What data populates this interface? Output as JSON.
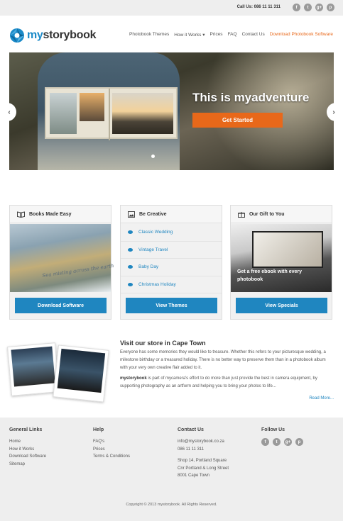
{
  "topbar": {
    "call_text": "Call Us: 086 11 11 311",
    "social": [
      {
        "icon": "facebook-icon",
        "glyph": "f"
      },
      {
        "icon": "twitter-icon",
        "glyph": "t"
      },
      {
        "icon": "google-plus-icon",
        "glyph": "g+"
      },
      {
        "icon": "pinterest-icon",
        "glyph": "p"
      }
    ]
  },
  "brand": {
    "my": "my",
    "rest": "storybook"
  },
  "nav": [
    {
      "label": "Photobook Themes"
    },
    {
      "label": "How it Works ▾"
    },
    {
      "label": "Prices"
    },
    {
      "label": "FAQ"
    },
    {
      "label": "Contact Us"
    },
    {
      "label": "Download Photobook Software",
      "highlight": true
    }
  ],
  "hero": {
    "title": "This is myadventure",
    "cta": "Get Started",
    "prev": "‹",
    "next": "›"
  },
  "cards": {
    "books": {
      "title": "Books Made Easy",
      "script": "Sea misting across the earth",
      "button": "Download Software"
    },
    "creative": {
      "title": "Be Creative",
      "links": [
        "Classic Wedding",
        "Vintage Travel",
        "Baby Day",
        "Christmas Holiday"
      ],
      "button": "View Themes"
    },
    "gift": {
      "title": "Our Gift to You",
      "overlay": "Get a free ebook with every photobook",
      "button": "View Specials"
    }
  },
  "store": {
    "title": "Visit our store in Cape Town",
    "p1": "Everyone has some memories they would like to treasure. Whether this refers to your picturesque wedding, a milestone birthday or a treasured holiday. There is no better way to preserve them than in a photobook album with your very own creative flair added to it.",
    "p2_brand": "mystorybook",
    "p2": " is part of mycamera's effort to do more than just provide the best in camera equipment, by supporting photography as an artform and helping you to bring your photos to life...",
    "read_more": "Read More..."
  },
  "footer": {
    "general": {
      "heading": "General Links",
      "links": [
        "Home",
        "How it Works",
        "Download Software",
        "Sitemap"
      ]
    },
    "help": {
      "heading": "Help",
      "links": [
        "FAQ's",
        "Prices",
        "Terms & Conditions"
      ]
    },
    "contact": {
      "heading": "Contact Us",
      "email": "info@mystorybook.co.za",
      "phone": "086 11 11 311",
      "address": [
        "Shop 14, Portland Square",
        "Cnr Portland & Long Street",
        "8001 Cape Town"
      ]
    },
    "follow": {
      "heading": "Follow Us"
    },
    "copyright": "Copyright © 2013 mystorybook. All Rights Reserved."
  },
  "colors": {
    "accent_blue": "#1f86c0",
    "accent_orange": "#e8681a"
  }
}
